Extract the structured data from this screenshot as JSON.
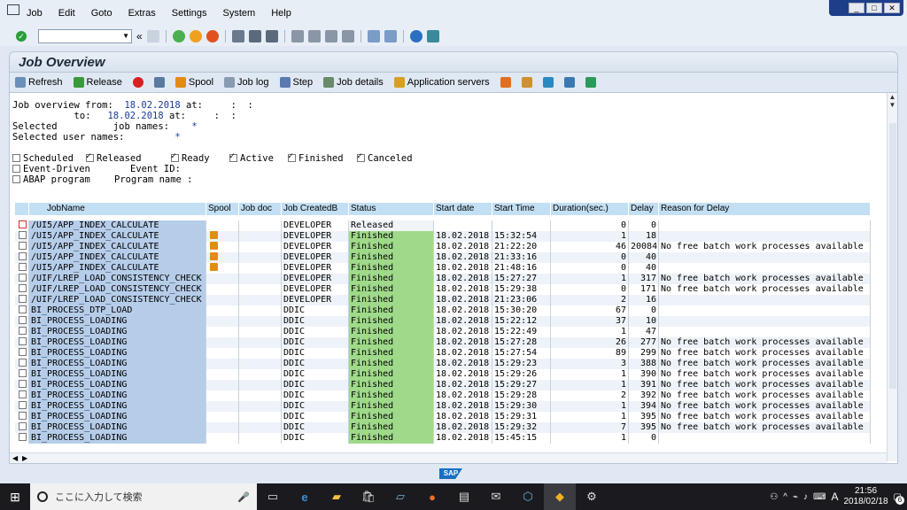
{
  "menu": [
    "Job",
    "Edit",
    "Goto",
    "Extras",
    "Settings",
    "System",
    "Help"
  ],
  "window_controls": [
    "_",
    "□",
    "✕"
  ],
  "page_title": "Job Overview",
  "app_toolbar": {
    "refresh": "Refresh",
    "release": "Release",
    "spool": "Spool",
    "job_log": "Job log",
    "step": "Step",
    "job_details": "Job details",
    "app_servers": "Application servers"
  },
  "selection": {
    "line1_label": "Job overview from:",
    "from_date": "18.02.2018",
    "at1": "at:",
    "time1": ":  :",
    "to_label": "to:",
    "to_date": "18.02.2018",
    "at2": "at:",
    "time2": ":  :",
    "selected_job_names_label1": "Selected",
    "selected_job_names_label2": "job names:",
    "job_names_value": "*",
    "selected_user_names_label": "Selected user names:",
    "user_names_value": "*",
    "statuses": [
      {
        "label": "Scheduled",
        "checked": false
      },
      {
        "label": "Released",
        "checked": true
      },
      {
        "label": "Ready",
        "checked": true
      },
      {
        "label": "Active",
        "checked": true
      },
      {
        "label": "Finished",
        "checked": true
      },
      {
        "label": "Canceled",
        "checked": true
      }
    ],
    "event_driven": "Event-Driven",
    "event_id_label": "Event ID:",
    "abap_program": "ABAP program",
    "program_name_label": "Program name :"
  },
  "table": {
    "headers": [
      "JobName",
      "Spool",
      "Job doc",
      "Job CreatedB",
      "Status",
      "Start date",
      "Start Time",
      "Duration(sec.)",
      "Delay",
      "Reason for Delay"
    ],
    "rows": [
      {
        "job": "/UI5/APP_INDEX_CALCULATE",
        "spool": false,
        "by": "DEVELOPER",
        "status": "Released",
        "date": "",
        "time": "",
        "dur": "0",
        "delay": "0",
        "reason": ""
      },
      {
        "job": "/UI5/APP_INDEX_CALCULATE",
        "spool": true,
        "by": "DEVELOPER",
        "status": "Finished",
        "date": "18.02.2018",
        "time": "15:32:54",
        "dur": "1",
        "delay": "18",
        "reason": ""
      },
      {
        "job": "/UI5/APP_INDEX_CALCULATE",
        "spool": true,
        "by": "DEVELOPER",
        "status": "Finished",
        "date": "18.02.2018",
        "time": "21:22:20",
        "dur": "46",
        "delay": "20084",
        "reason": "No free batch work processes available"
      },
      {
        "job": "/UI5/APP_INDEX_CALCULATE",
        "spool": true,
        "by": "DEVELOPER",
        "status": "Finished",
        "date": "18.02.2018",
        "time": "21:33:16",
        "dur": "0",
        "delay": "40",
        "reason": ""
      },
      {
        "job": "/UI5/APP_INDEX_CALCULATE",
        "spool": true,
        "by": "DEVELOPER",
        "status": "Finished",
        "date": "18.02.2018",
        "time": "21:48:16",
        "dur": "0",
        "delay": "40",
        "reason": ""
      },
      {
        "job": "/UIF/LREP_LOAD_CONSISTENCY_CHECK",
        "spool": false,
        "by": "DEVELOPER",
        "status": "Finished",
        "date": "18.02.2018",
        "time": "15:27:27",
        "dur": "1",
        "delay": "317",
        "reason": "No free batch work processes available"
      },
      {
        "job": "/UIF/LREP_LOAD_CONSISTENCY_CHECK",
        "spool": false,
        "by": "DEVELOPER",
        "status": "Finished",
        "date": "18.02.2018",
        "time": "15:29:38",
        "dur": "0",
        "delay": "171",
        "reason": "No free batch work processes available"
      },
      {
        "job": "/UIF/LREP_LOAD_CONSISTENCY_CHECK",
        "spool": false,
        "by": "DEVELOPER",
        "status": "Finished",
        "date": "18.02.2018",
        "time": "21:23:06",
        "dur": "2",
        "delay": "16",
        "reason": ""
      },
      {
        "job": "BI_PROCESS_DTP_LOAD",
        "spool": false,
        "by": "DDIC",
        "status": "Finished",
        "date": "18.02.2018",
        "time": "15:30:20",
        "dur": "67",
        "delay": "0",
        "reason": ""
      },
      {
        "job": "BI_PROCESS_LOADING",
        "spool": false,
        "by": "DDIC",
        "status": "Finished",
        "date": "18.02.2018",
        "time": "15:22:12",
        "dur": "37",
        "delay": "10",
        "reason": ""
      },
      {
        "job": "BI_PROCESS_LOADING",
        "spool": false,
        "by": "DDIC",
        "status": "Finished",
        "date": "18.02.2018",
        "time": "15:22:49",
        "dur": "1",
        "delay": "47",
        "reason": ""
      },
      {
        "job": "BI_PROCESS_LOADING",
        "spool": false,
        "by": "DDIC",
        "status": "Finished",
        "date": "18.02.2018",
        "time": "15:27:28",
        "dur": "26",
        "delay": "277",
        "reason": "No free batch work processes available"
      },
      {
        "job": "BI_PROCESS_LOADING",
        "spool": false,
        "by": "DDIC",
        "status": "Finished",
        "date": "18.02.2018",
        "time": "15:27:54",
        "dur": "89",
        "delay": "299",
        "reason": "No free batch work processes available"
      },
      {
        "job": "BI_PROCESS_LOADING",
        "spool": false,
        "by": "DDIC",
        "status": "Finished",
        "date": "18.02.2018",
        "time": "15:29:23",
        "dur": "3",
        "delay": "388",
        "reason": "No free batch work processes available"
      },
      {
        "job": "BI_PROCESS_LOADING",
        "spool": false,
        "by": "DDIC",
        "status": "Finished",
        "date": "18.02.2018",
        "time": "15:29:26",
        "dur": "1",
        "delay": "390",
        "reason": "No free batch work processes available"
      },
      {
        "job": "BI_PROCESS_LOADING",
        "spool": false,
        "by": "DDIC",
        "status": "Finished",
        "date": "18.02.2018",
        "time": "15:29:27",
        "dur": "1",
        "delay": "391",
        "reason": "No free batch work processes available"
      },
      {
        "job": "BI_PROCESS_LOADING",
        "spool": false,
        "by": "DDIC",
        "status": "Finished",
        "date": "18.02.2018",
        "time": "15:29:28",
        "dur": "2",
        "delay": "392",
        "reason": "No free batch work processes available"
      },
      {
        "job": "BI_PROCESS_LOADING",
        "spool": false,
        "by": "DDIC",
        "status": "Finished",
        "date": "18.02.2018",
        "time": "15:29:30",
        "dur": "1",
        "delay": "394",
        "reason": "No free batch work processes available"
      },
      {
        "job": "BI_PROCESS_LOADING",
        "spool": false,
        "by": "DDIC",
        "status": "Finished",
        "date": "18.02.2018",
        "time": "15:29:31",
        "dur": "1",
        "delay": "395",
        "reason": "No free batch work processes available"
      },
      {
        "job": "BI_PROCESS_LOADING",
        "spool": false,
        "by": "DDIC",
        "status": "Finished",
        "date": "18.02.2018",
        "time": "15:29:32",
        "dur": "7",
        "delay": "395",
        "reason": "No free batch work processes available"
      },
      {
        "job": "BI_PROCESS_LOADING",
        "spool": false,
        "by": "DDIC",
        "status": "Finished",
        "date": "18.02.2018",
        "time": "15:45:15",
        "dur": "1",
        "delay": "0",
        "reason": ""
      }
    ]
  },
  "status_logo": "SAP",
  "taskbar": {
    "search_placeholder": "ここに入力して検索",
    "time": "21:56",
    "date": "2018/02/18",
    "ime": "A",
    "notifications": "6"
  }
}
